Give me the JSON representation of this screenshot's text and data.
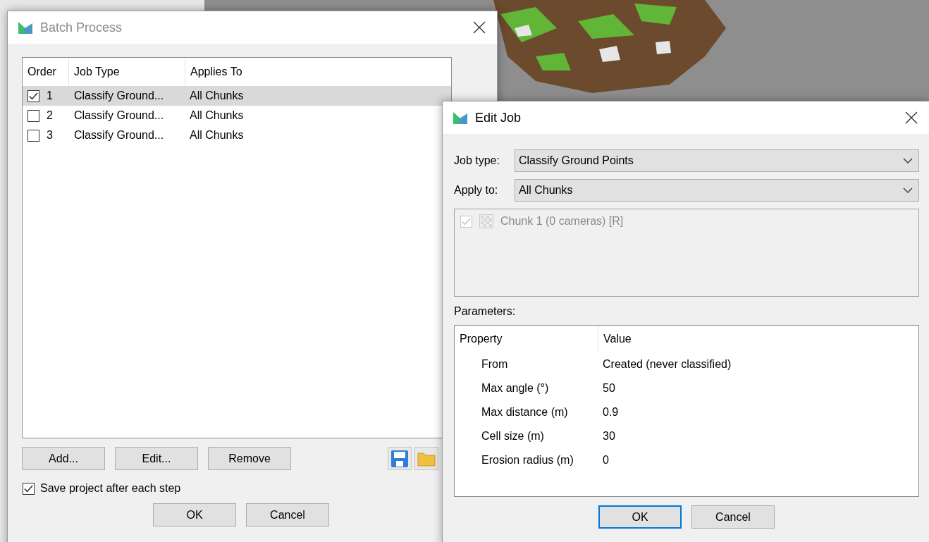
{
  "batch_process": {
    "title": "Batch Process",
    "columns": [
      "Order",
      "Job Type",
      "Applies To"
    ],
    "rows": [
      {
        "checked": true,
        "selected": true,
        "order": "1",
        "job_type": "Classify Ground...",
        "applies_to": "All Chunks"
      },
      {
        "checked": false,
        "selected": false,
        "order": "2",
        "job_type": "Classify Ground...",
        "applies_to": "All Chunks"
      },
      {
        "checked": false,
        "selected": false,
        "order": "3",
        "job_type": "Classify Ground...",
        "applies_to": "All Chunks"
      }
    ],
    "buttons": [
      "Add...",
      "Edit...",
      "Remove"
    ],
    "save_after_each_step": {
      "label": "Save project after each step",
      "checked": true
    },
    "dialog_buttons": [
      {
        "label": "OK",
        "focused": false
      },
      {
        "label": "Cancel",
        "focused": false
      }
    ]
  },
  "edit_job": {
    "title": "Edit Job",
    "job_type": {
      "label": "Job type:",
      "value": "Classify Ground Points"
    },
    "apply_to": {
      "label": "Apply to:",
      "value": "All Chunks"
    },
    "chunks": [
      {
        "label": "Chunk 1 (0 cameras) [R]",
        "checked": true,
        "disabled": true
      }
    ],
    "parameters_label": "Parameters:",
    "parameters": {
      "columns": [
        "Property",
        "Value"
      ],
      "rows": [
        {
          "property": "From",
          "value": "Created (never classified)"
        },
        {
          "property": "Max angle (°)",
          "value": "50"
        },
        {
          "property": "Max distance (m)",
          "value": "0.9"
        },
        {
          "property": "Cell size (m)",
          "value": "30"
        },
        {
          "property": "Erosion radius (m)",
          "value": "0"
        }
      ]
    },
    "dialog_buttons": [
      {
        "label": "OK",
        "focused": true
      },
      {
        "label": "Cancel",
        "focused": false
      }
    ]
  }
}
